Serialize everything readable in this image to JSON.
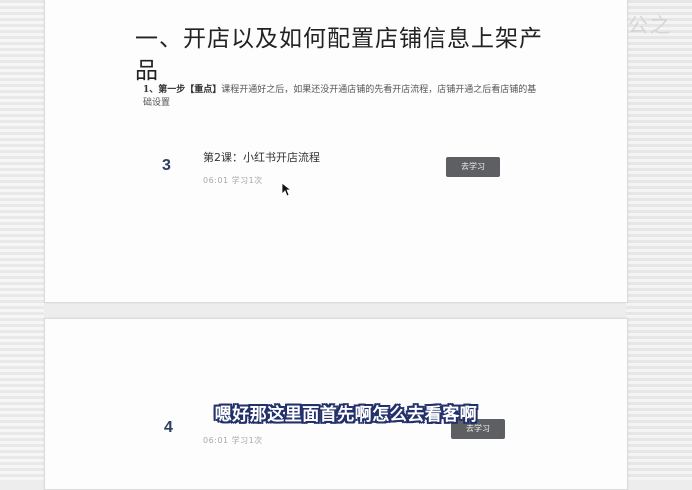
{
  "ghost_side_text": "公之",
  "document": {
    "title": "一、开店以及如何配置店铺信息上架产品",
    "step": {
      "prefix": "1、第一步【重点】",
      "body": "课程开通好之后，如果还没开通店铺的先看开店流程，店铺开通之后看店铺的基础设置"
    }
  },
  "lessons": [
    {
      "number": "3",
      "title": "第2课：小红书开店流程",
      "meta": "06:01  学习1次",
      "button": "去学习"
    },
    {
      "number": "4",
      "title": "",
      "meta": "06:01  学习1次",
      "button": "去学习"
    }
  ],
  "subtitle": "嗯好那这里面首先啊怎么去看客啊"
}
